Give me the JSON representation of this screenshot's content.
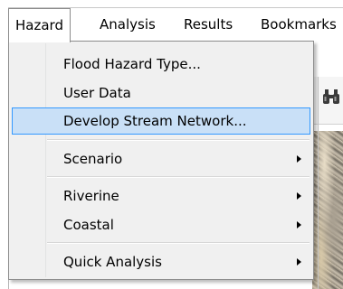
{
  "menubar": {
    "items": [
      {
        "label": "Hazard",
        "open": true
      },
      {
        "label": "Analysis"
      },
      {
        "label": "Results"
      },
      {
        "label": "Bookmarks"
      }
    ]
  },
  "dropdown": {
    "items": [
      {
        "label": "Flood Hazard Type...",
        "submenu": false
      },
      {
        "label": "User Data",
        "submenu": false
      },
      {
        "label": "Develop Stream Network...",
        "submenu": false,
        "highlighted": true
      },
      {
        "label": "Scenario",
        "submenu": true
      },
      {
        "label": "Riverine",
        "submenu": true
      },
      {
        "label": "Coastal",
        "submenu": true
      },
      {
        "label": "Quick Analysis",
        "submenu": true
      }
    ]
  },
  "background": {
    "toolbar_icon": "binoculars-icon"
  },
  "colors": {
    "highlight_fill": "#c9e0f7",
    "highlight_border": "#3399ff",
    "menu_background": "#f0f0f0"
  }
}
